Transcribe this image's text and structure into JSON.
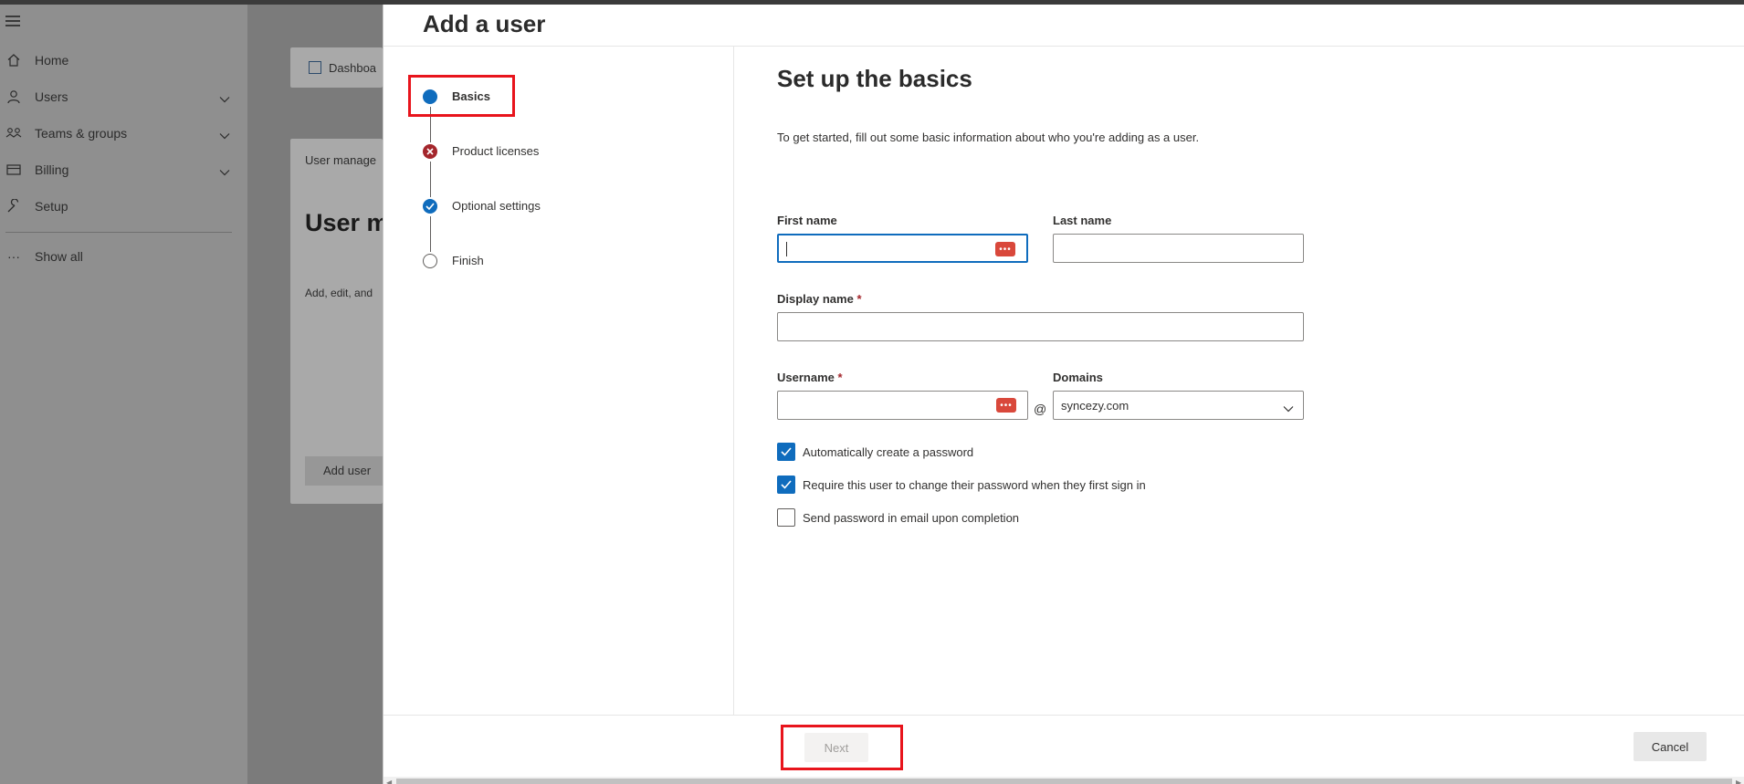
{
  "left_nav": {
    "items": [
      {
        "label": "Home",
        "icon": "home-icon"
      },
      {
        "label": "Users",
        "icon": "person-icon",
        "expandable": true
      },
      {
        "label": "Teams & groups",
        "icon": "people-icon",
        "expandable": true
      },
      {
        "label": "Billing",
        "icon": "card-icon",
        "expandable": true
      },
      {
        "label": "Setup",
        "icon": "wrench-icon"
      }
    ],
    "show_all": "Show all"
  },
  "background": {
    "dashboard_tab": "Dashboa",
    "breadcrumb": "User manage",
    "title": "User m",
    "description": "Add, edit, and",
    "add_user_button": "Add user"
  },
  "panel": {
    "title": "Add a user",
    "steps": [
      {
        "label": "Basics",
        "state": "active"
      },
      {
        "label": "Product licenses",
        "state": "error"
      },
      {
        "label": "Optional settings",
        "state": "done"
      },
      {
        "label": "Finish",
        "state": "pending"
      }
    ],
    "form": {
      "title": "Set up the basics",
      "description": "To get started, fill out some basic information about who you're adding as a user.",
      "first_name": {
        "label": "First name",
        "value": ""
      },
      "last_name": {
        "label": "Last name",
        "value": ""
      },
      "display_name": {
        "label": "Display name",
        "required_mark": "*",
        "value": ""
      },
      "username": {
        "label": "Username",
        "required_mark": "*",
        "value": ""
      },
      "at_symbol": "@",
      "domains": {
        "label": "Domains",
        "selected": "syncezy.com"
      },
      "checkboxes": [
        {
          "label": "Automatically create a password",
          "checked": true
        },
        {
          "label": "Require this user to change their password when they first sign in",
          "checked": true
        },
        {
          "label": "Send password in email upon completion",
          "checked": false
        }
      ]
    },
    "footer": {
      "next": "Next",
      "cancel": "Cancel"
    }
  },
  "colors": {
    "accent": "#0f6cbd",
    "error": "#a4262c",
    "highlight": "#e8141c",
    "password_badge": "#d9483b"
  }
}
